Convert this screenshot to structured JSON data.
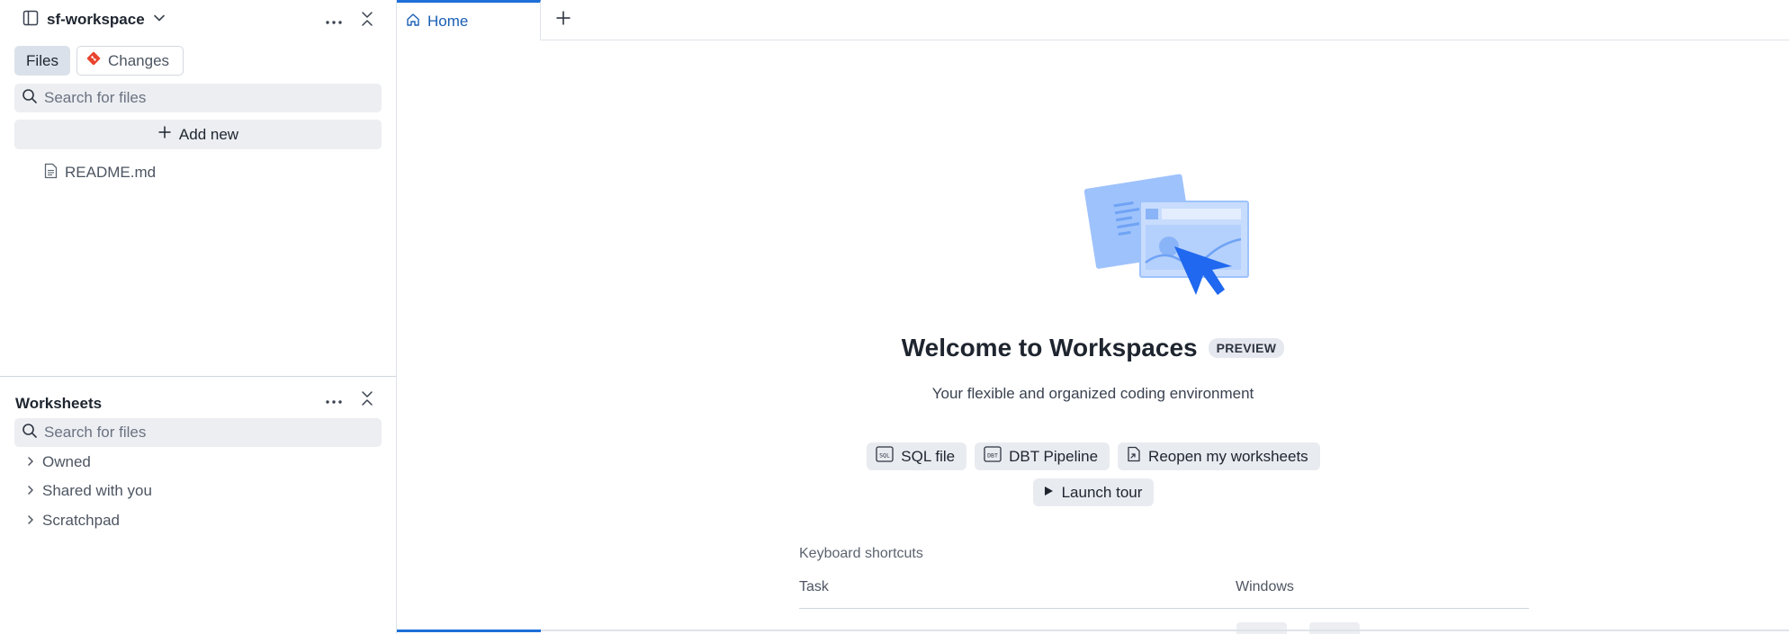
{
  "sidebar": {
    "workspace_name": "sf-workspace",
    "toggles": {
      "files_label": "Files",
      "changes_label": "Changes"
    },
    "search_placeholder": "Search for files",
    "add_new_label": "Add new",
    "files": [
      {
        "name": "README.md",
        "icon": "file-text-icon"
      }
    ],
    "worksheets": {
      "title": "Worksheets",
      "search_placeholder": "Search for files",
      "items": [
        {
          "label": "Owned"
        },
        {
          "label": "Shared with you"
        },
        {
          "label": "Scratchpad"
        }
      ]
    }
  },
  "tabs": [
    {
      "label": "Home",
      "icon": "home-icon",
      "active": true
    }
  ],
  "home": {
    "title": "Welcome to Workspaces",
    "badge": "PREVIEW",
    "subtitle": "Your flexible and organized coding environment",
    "actions": [
      {
        "label": "SQL file",
        "icon": "sql-file-icon"
      },
      {
        "label": "DBT Pipeline",
        "icon": "dbt-icon"
      },
      {
        "label": "Reopen my worksheets",
        "icon": "reopen-file-icon"
      }
    ],
    "tour_label": "Launch tour",
    "shortcuts": {
      "title": "Keyboard shortcuts",
      "col_task": "Task",
      "col_windows": "Windows"
    }
  },
  "colors": {
    "accent": "#1e6fd9",
    "active_tab_text": "#1a5fb4",
    "git_icon": "#e8442e",
    "button_bg": "#e8ebf0"
  }
}
